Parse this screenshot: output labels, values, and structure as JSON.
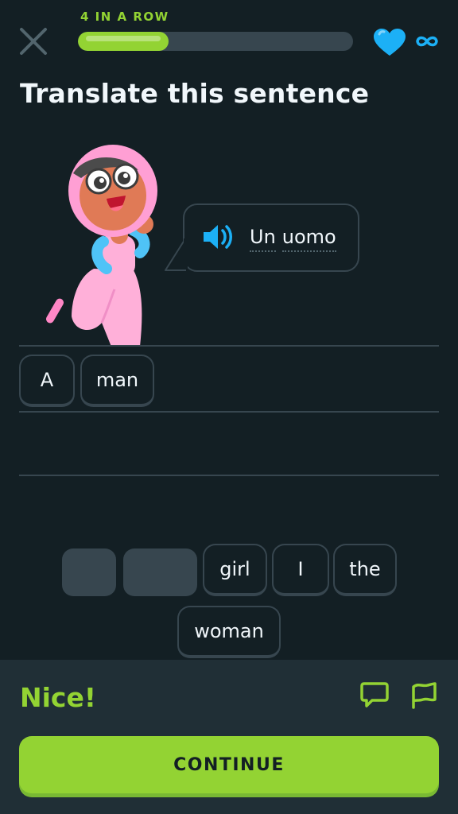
{
  "header": {
    "streak_label": "4 IN A ROW",
    "progress": 0.33,
    "hearts_label": "∞",
    "colors": {
      "accent": "#93d333",
      "heart": "#1cb0f6",
      "track": "#37464f"
    },
    "icons": [
      "close-icon",
      "heart-icon",
      "infinity-icon"
    ]
  },
  "exercise": {
    "title": "Translate this sentence",
    "prompt_words": [
      "Un",
      "uomo"
    ],
    "answer_words": [
      "A",
      "man"
    ],
    "word_bank": [
      "girl",
      "I",
      "the",
      "woman"
    ]
  },
  "feedback": {
    "title": "Nice!",
    "continue_label": "CONTINUE",
    "icons": [
      "comment-icon",
      "flag-icon"
    ]
  }
}
